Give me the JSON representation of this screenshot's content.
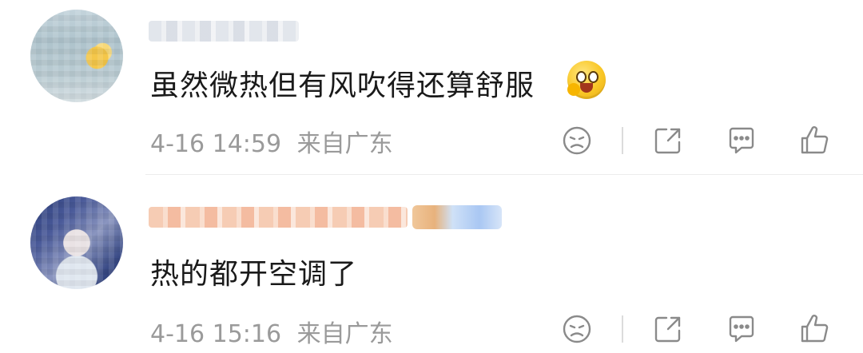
{
  "comments": [
    {
      "text": "虽然微热但有风吹得还算舒服",
      "time": "4-16 14:59",
      "location": "来自广东"
    },
    {
      "text": "热的都开空调了",
      "time": "4-16 15:16",
      "location": "来自广东"
    }
  ],
  "colors": {
    "text": "#1a1a1a",
    "meta": "#9a9a9a",
    "icon": "#8a8a8a",
    "divider": "#ececec"
  }
}
